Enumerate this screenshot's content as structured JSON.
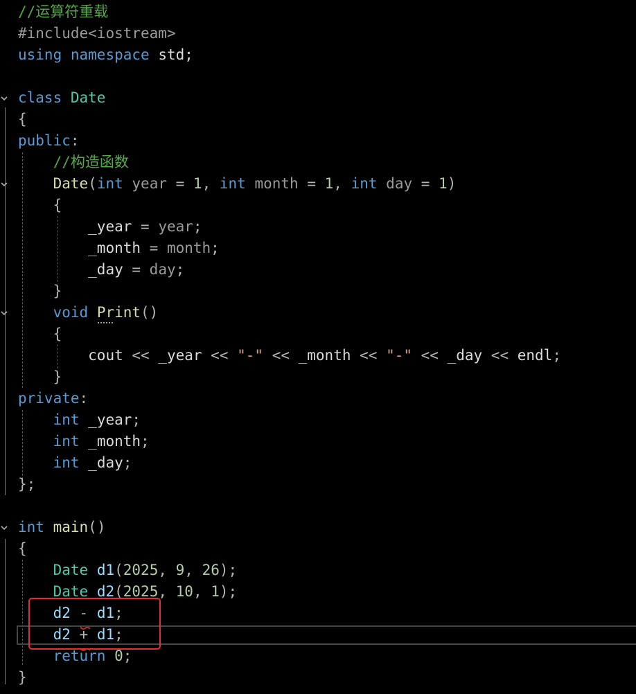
{
  "editor": {
    "language": "C++",
    "colors": {
      "background": "#000000",
      "comment": "#57a64a",
      "keyword": "#569cd6",
      "type": "#4ec9b0",
      "function": "#dcdcaa",
      "number": "#b5cea8",
      "string": "#d69d85",
      "highlight_box": "#e03131"
    },
    "lines": [
      {
        "tokens": [
          {
            "t": "//运算符重载",
            "c": "comment"
          }
        ]
      },
      {
        "tokens": [
          {
            "t": "#include",
            "c": "pre"
          },
          {
            "t": "<iostream>",
            "c": "pre"
          }
        ]
      },
      {
        "tokens": [
          {
            "t": "using",
            "c": "kw"
          },
          {
            "t": " ",
            "c": "ident"
          },
          {
            "t": "namespace",
            "c": "kw"
          },
          {
            "t": " std;",
            "c": "ident"
          }
        ]
      },
      {
        "tokens": []
      },
      {
        "tokens": [
          {
            "t": "class",
            "c": "kw"
          },
          {
            "t": " ",
            "c": "ident"
          },
          {
            "t": "Date",
            "c": "type"
          }
        ]
      },
      {
        "tokens": [
          {
            "t": "{",
            "c": "punc"
          }
        ]
      },
      {
        "tokens": [
          {
            "t": "public",
            "c": "kw"
          },
          {
            "t": ":",
            "c": "punc"
          }
        ]
      },
      {
        "tokens": [
          {
            "t": "    ",
            "c": "ident"
          },
          {
            "t": "//构造函数",
            "c": "comment"
          }
        ]
      },
      {
        "tokens": [
          {
            "t": "    ",
            "c": "ident"
          },
          {
            "t": "Date",
            "c": "fn"
          },
          {
            "t": "(",
            "c": "punc"
          },
          {
            "t": "int",
            "c": "kw"
          },
          {
            "t": " ",
            "c": "ident"
          },
          {
            "t": "year",
            "c": "param"
          },
          {
            "t": " = ",
            "c": "op"
          },
          {
            "t": "1",
            "c": "num"
          },
          {
            "t": ", ",
            "c": "punc"
          },
          {
            "t": "int",
            "c": "kw"
          },
          {
            "t": " ",
            "c": "ident"
          },
          {
            "t": "month",
            "c": "param"
          },
          {
            "t": " = ",
            "c": "op"
          },
          {
            "t": "1",
            "c": "num"
          },
          {
            "t": ", ",
            "c": "punc"
          },
          {
            "t": "int",
            "c": "kw"
          },
          {
            "t": " ",
            "c": "ident"
          },
          {
            "t": "day",
            "c": "param"
          },
          {
            "t": " = ",
            "c": "op"
          },
          {
            "t": "1",
            "c": "num"
          },
          {
            "t": ")",
            "c": "punc"
          }
        ]
      },
      {
        "tokens": [
          {
            "t": "    ",
            "c": "ident"
          },
          {
            "t": "{",
            "c": "punc"
          }
        ]
      },
      {
        "tokens": [
          {
            "t": "        ",
            "c": "ident"
          },
          {
            "t": "_year",
            "c": "field"
          },
          {
            "t": " = ",
            "c": "op"
          },
          {
            "t": "year",
            "c": "param"
          },
          {
            "t": ";",
            "c": "punc"
          }
        ]
      },
      {
        "tokens": [
          {
            "t": "        ",
            "c": "ident"
          },
          {
            "t": "_month",
            "c": "field"
          },
          {
            "t": " = ",
            "c": "op"
          },
          {
            "t": "month",
            "c": "param"
          },
          {
            "t": ";",
            "c": "punc"
          }
        ]
      },
      {
        "tokens": [
          {
            "t": "        ",
            "c": "ident"
          },
          {
            "t": "_day",
            "c": "field"
          },
          {
            "t": " = ",
            "c": "op"
          },
          {
            "t": "day",
            "c": "param"
          },
          {
            "t": ";",
            "c": "punc"
          }
        ]
      },
      {
        "tokens": [
          {
            "t": "    ",
            "c": "ident"
          },
          {
            "t": "}",
            "c": "punc"
          }
        ]
      },
      {
        "tokens": [
          {
            "t": "    ",
            "c": "ident"
          },
          {
            "t": "void",
            "c": "kw"
          },
          {
            "t": " ",
            "c": "ident"
          },
          {
            "t": "Print",
            "c": "fn"
          },
          {
            "t": "()",
            "c": "punc"
          }
        ]
      },
      {
        "tokens": [
          {
            "t": "    ",
            "c": "ident"
          },
          {
            "t": "{",
            "c": "punc"
          }
        ]
      },
      {
        "tokens": [
          {
            "t": "        ",
            "c": "ident"
          },
          {
            "t": "cout",
            "c": "ident"
          },
          {
            "t": " << ",
            "c": "op"
          },
          {
            "t": "_year",
            "c": "field"
          },
          {
            "t": " << ",
            "c": "op"
          },
          {
            "t": "\"-\"",
            "c": "str"
          },
          {
            "t": " << ",
            "c": "op"
          },
          {
            "t": "_month",
            "c": "field"
          },
          {
            "t": " << ",
            "c": "op"
          },
          {
            "t": "\"-\"",
            "c": "str"
          },
          {
            "t": " << ",
            "c": "op"
          },
          {
            "t": "_day",
            "c": "field"
          },
          {
            "t": " << ",
            "c": "op"
          },
          {
            "t": "endl",
            "c": "ident"
          },
          {
            "t": ";",
            "c": "punc"
          }
        ]
      },
      {
        "tokens": [
          {
            "t": "    ",
            "c": "ident"
          },
          {
            "t": "}",
            "c": "punc"
          }
        ]
      },
      {
        "tokens": [
          {
            "t": "private",
            "c": "kw"
          },
          {
            "t": ":",
            "c": "punc"
          }
        ]
      },
      {
        "tokens": [
          {
            "t": "    ",
            "c": "ident"
          },
          {
            "t": "int",
            "c": "kw"
          },
          {
            "t": " ",
            "c": "ident"
          },
          {
            "t": "_year",
            "c": "field"
          },
          {
            "t": ";",
            "c": "punc"
          }
        ]
      },
      {
        "tokens": [
          {
            "t": "    ",
            "c": "ident"
          },
          {
            "t": "int",
            "c": "kw"
          },
          {
            "t": " ",
            "c": "ident"
          },
          {
            "t": "_month",
            "c": "field"
          },
          {
            "t": ";",
            "c": "punc"
          }
        ]
      },
      {
        "tokens": [
          {
            "t": "    ",
            "c": "ident"
          },
          {
            "t": "int",
            "c": "kw"
          },
          {
            "t": " ",
            "c": "ident"
          },
          {
            "t": "_day",
            "c": "field"
          },
          {
            "t": ";",
            "c": "punc"
          }
        ]
      },
      {
        "tokens": [
          {
            "t": "}",
            "c": "punc"
          },
          {
            "t": ";",
            "c": "punc"
          }
        ]
      },
      {
        "tokens": []
      },
      {
        "tokens": [
          {
            "t": "int",
            "c": "kw"
          },
          {
            "t": " ",
            "c": "ident"
          },
          {
            "t": "main",
            "c": "fn"
          },
          {
            "t": "()",
            "c": "punc"
          }
        ]
      },
      {
        "tokens": [
          {
            "t": "{",
            "c": "punc"
          }
        ]
      },
      {
        "tokens": [
          {
            "t": "    ",
            "c": "ident"
          },
          {
            "t": "Date",
            "c": "type"
          },
          {
            "t": " ",
            "c": "ident"
          },
          {
            "t": "d1",
            "c": "var"
          },
          {
            "t": "(",
            "c": "punc"
          },
          {
            "t": "2025",
            "c": "num"
          },
          {
            "t": ", ",
            "c": "punc"
          },
          {
            "t": "9",
            "c": "num"
          },
          {
            "t": ", ",
            "c": "punc"
          },
          {
            "t": "26",
            "c": "num"
          },
          {
            "t": ");",
            "c": "punc"
          }
        ]
      },
      {
        "tokens": [
          {
            "t": "    ",
            "c": "ident"
          },
          {
            "t": "Date",
            "c": "type"
          },
          {
            "t": " ",
            "c": "ident"
          },
          {
            "t": "d2",
            "c": "var"
          },
          {
            "t": "(",
            "c": "punc"
          },
          {
            "t": "2025",
            "c": "num"
          },
          {
            "t": ", ",
            "c": "punc"
          },
          {
            "t": "10",
            "c": "num"
          },
          {
            "t": ", ",
            "c": "punc"
          },
          {
            "t": "1",
            "c": "num"
          },
          {
            "t": ");",
            "c": "punc"
          }
        ]
      },
      {
        "tokens": [
          {
            "t": "    ",
            "c": "ident"
          },
          {
            "t": "d2",
            "c": "var"
          },
          {
            "t": " - ",
            "c": "op"
          },
          {
            "t": "d1",
            "c": "var"
          },
          {
            "t": ";",
            "c": "punc"
          }
        ]
      },
      {
        "tokens": [
          {
            "t": "    ",
            "c": "ident"
          },
          {
            "t": "d2",
            "c": "var"
          },
          {
            "t": " + ",
            "c": "op"
          },
          {
            "t": "d1",
            "c": "var"
          },
          {
            "t": ";",
            "c": "punc"
          }
        ]
      },
      {
        "tokens": [
          {
            "t": "    ",
            "c": "ident"
          },
          {
            "t": "return",
            "c": "kw"
          },
          {
            "t": " ",
            "c": "ident"
          },
          {
            "t": "0",
            "c": "num"
          },
          {
            "t": ";",
            "c": "punc"
          }
        ]
      },
      {
        "tokens": [
          {
            "t": "}",
            "c": "punc"
          }
        ]
      }
    ],
    "fold_markers": [
      {
        "icon": "chevron-down-icon",
        "line": 4
      },
      {
        "icon": "chevron-down-icon",
        "line": 8
      },
      {
        "icon": "chevron-down-icon",
        "line": 14
      },
      {
        "icon": "chevron-down-icon",
        "line": 24
      }
    ],
    "error_squiggles": [
      {
        "line": 28,
        "icon": "error-squiggle-icon"
      },
      {
        "line": 29,
        "icon": "error-squiggle-icon"
      }
    ],
    "current_line": 29,
    "highlight_box_lines": [
      28,
      29
    ]
  }
}
